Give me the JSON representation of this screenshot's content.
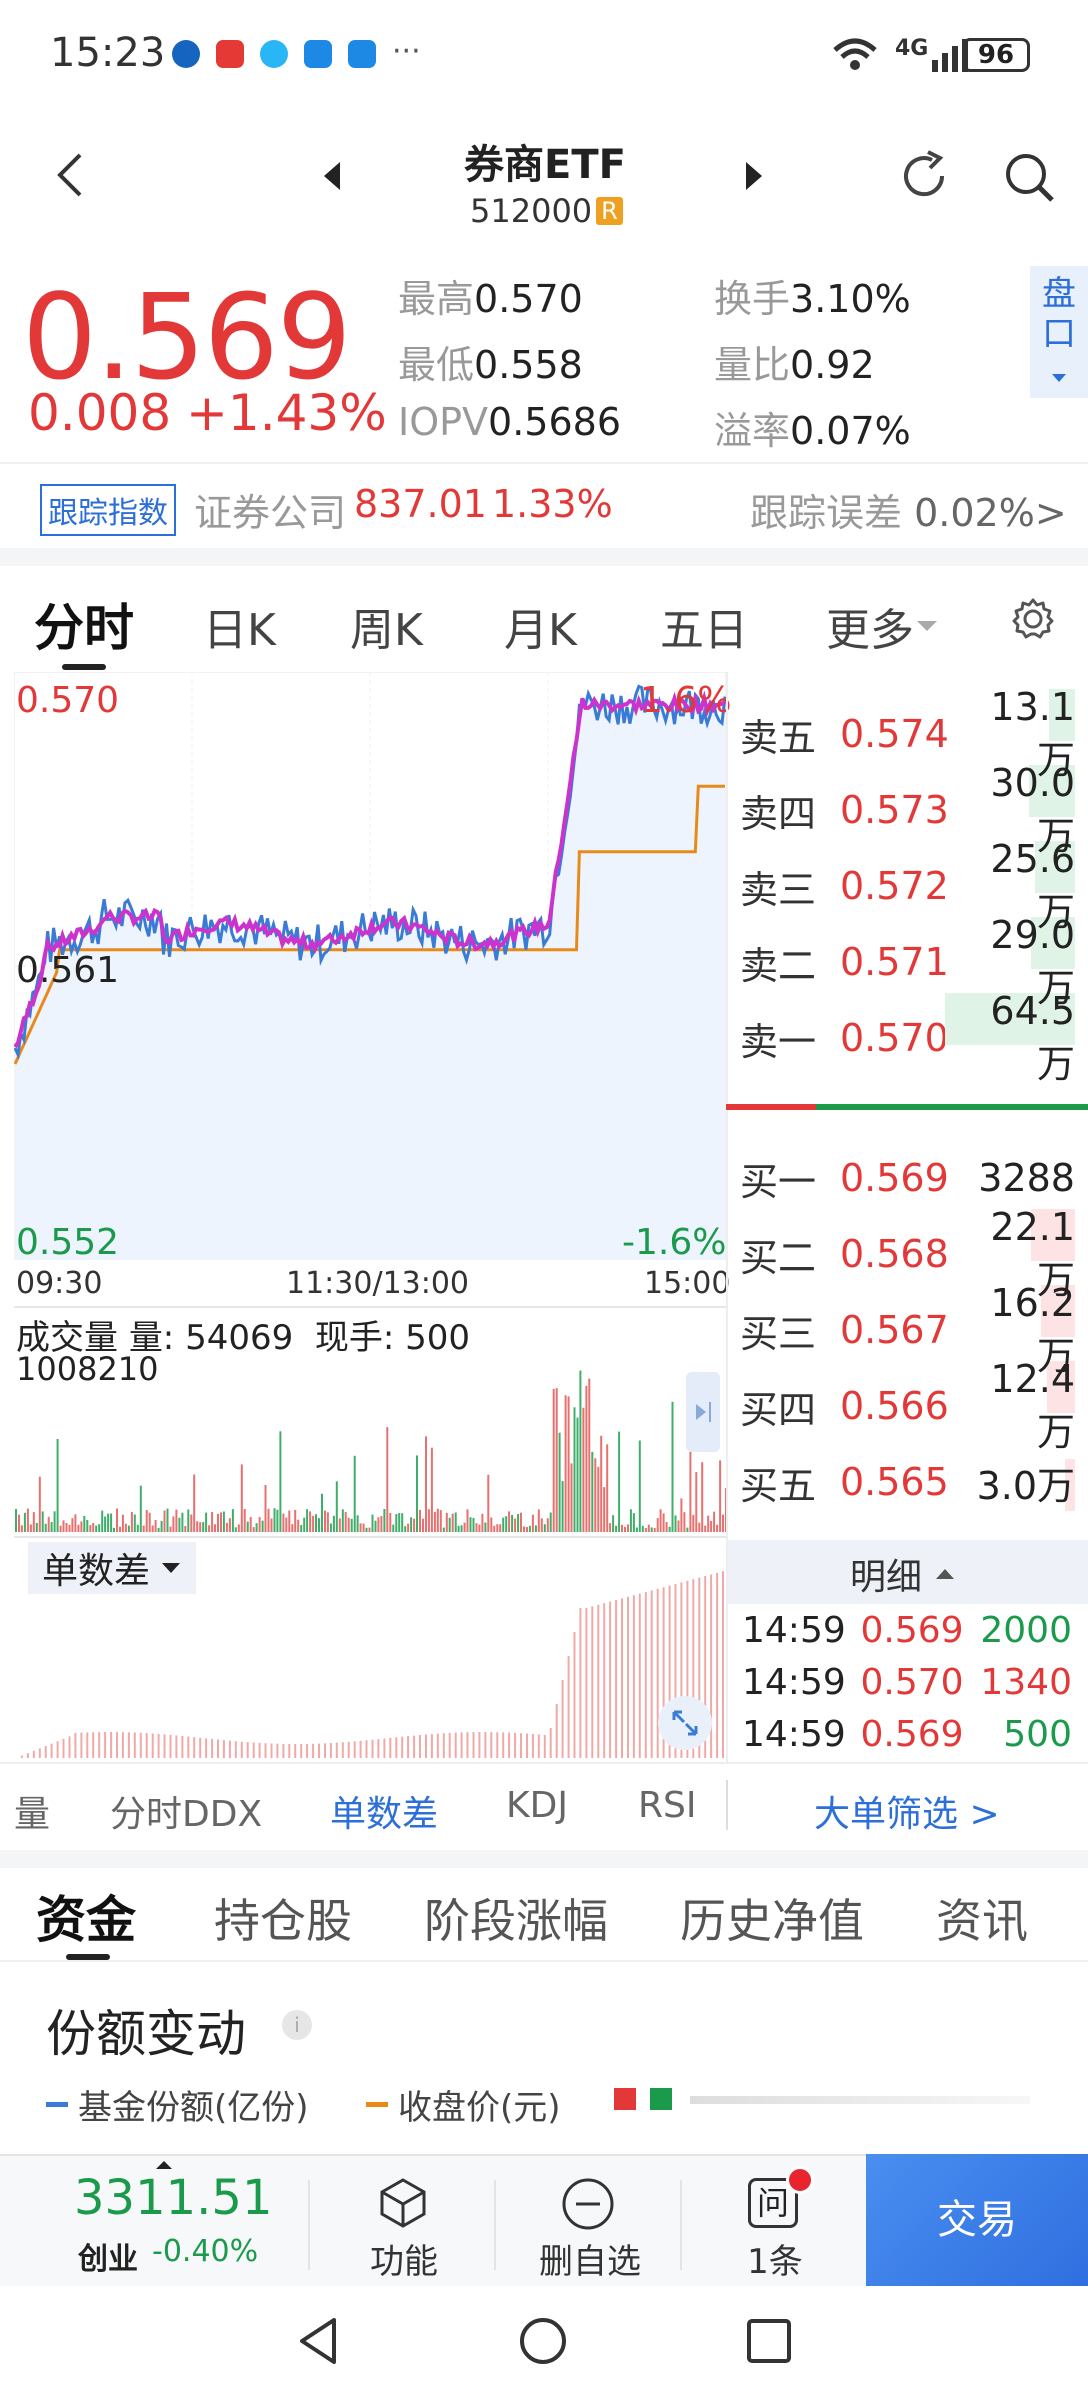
{
  "status": {
    "time": "15:23",
    "battery": "96",
    "more": "···",
    "network": "4G"
  },
  "header": {
    "title": "券商ETF",
    "code": "512000",
    "badge": "R"
  },
  "quote": {
    "price": "0.569",
    "change": "0.008",
    "pct": "+1.43%"
  },
  "stats": [
    {
      "label": "最高",
      "value": "0.570"
    },
    {
      "label": "换手",
      "value": "3.10%"
    },
    {
      "label": "最低",
      "value": "0.558"
    },
    {
      "label": "量比",
      "value": "0.92"
    },
    {
      "label": "IOPV",
      "value": "0.5686"
    },
    {
      "label": "溢率",
      "value": "0.07%"
    }
  ],
  "side_tab": {
    "line1": "盘",
    "line2": "口"
  },
  "index": {
    "tag": "跟踪指数",
    "name": "证券公司",
    "value": "837.01",
    "pct": "1.33%",
    "err_label": "跟踪误差",
    "err_value": "0.02%",
    "arrow": ">"
  },
  "tabs": [
    "分时",
    "日K",
    "周K",
    "月K",
    "五日",
    "更多"
  ],
  "chart_labels": {
    "high": "0.570",
    "mid": "0.561",
    "low": "0.552",
    "pct_high": "1.6%",
    "pct_low": "-1.6%",
    "t1": "09:30",
    "t2": "11:30/13:00",
    "t3": "15:00"
  },
  "volume": {
    "title": "成交量",
    "vol_label": "量:",
    "vol": "54069",
    "hand_label": "现手:",
    "hand": "500",
    "max": "1008210"
  },
  "diff_label": "单数差",
  "orderbook": {
    "sell": [
      {
        "l": "卖五",
        "p": "0.574",
        "v": "13.1万"
      },
      {
        "l": "卖四",
        "p": "0.573",
        "v": "30.0万"
      },
      {
        "l": "卖三",
        "p": "0.572",
        "v": "25.6万"
      },
      {
        "l": "卖二",
        "p": "0.571",
        "v": "29.0万"
      },
      {
        "l": "卖一",
        "p": "0.570",
        "v": "64.5万"
      }
    ],
    "buy": [
      {
        "l": "买一",
        "p": "0.569",
        "v": "3288"
      },
      {
        "l": "买二",
        "p": "0.568",
        "v": "22.1万"
      },
      {
        "l": "买三",
        "p": "0.567",
        "v": "16.2万"
      },
      {
        "l": "买四",
        "p": "0.566",
        "v": "12.4万"
      },
      {
        "l": "买五",
        "p": "0.565",
        "v": "3.0万"
      }
    ]
  },
  "ticks": {
    "title": "明细",
    "rows": [
      {
        "t": "14:59",
        "p": "0.569",
        "v": "2000"
      },
      {
        "t": "14:59",
        "p": "0.570",
        "v": "1340"
      },
      {
        "t": "14:59",
        "p": "0.569",
        "v": "500"
      }
    ]
  },
  "ind_tabs": [
    "量",
    "分时DDX",
    "单数差",
    "KDJ",
    "RSI"
  ],
  "big_filter": "大单筛选 >",
  "bottom_tabs": [
    "资金",
    "持仓股",
    "阶段涨幅",
    "历史净值",
    "资讯"
  ],
  "share": {
    "title": "份额变动",
    "legend1": "基金份额(亿份)",
    "legend2": "收盘价(元)"
  },
  "nav": {
    "index_value": "3311.51",
    "index_name": "创业",
    "index_pct": "-0.40%",
    "func": "功能",
    "del": "删自选",
    "ask": "1条",
    "ask_icon": "问",
    "trade": "交易"
  },
  "colors": {
    "up": "#e23838",
    "down": "#1a9a4a",
    "price_line": "#3a7bd5",
    "avg_line": "#cc33cc",
    "ref_line": "#e88a1a"
  }
}
